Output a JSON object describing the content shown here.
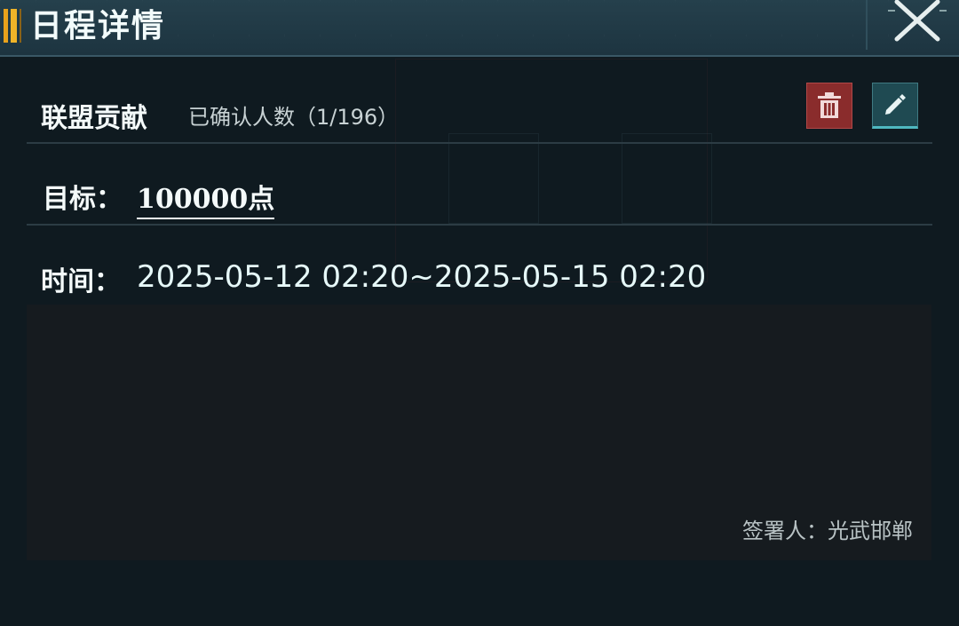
{
  "header": {
    "title": "日程详情"
  },
  "event": {
    "name": "联盟贡献",
    "confirmed_text": "已确认人数（1/196）",
    "target_label": "目标：",
    "target_value": "100000点",
    "time_label": "时间：",
    "time_value": "2025-05-12 02:20~2025-05-15 02:20",
    "signer": "签署人：光武邯郸"
  },
  "actions": {
    "delete_icon": "trash-icon",
    "edit_icon": "pencil-icon",
    "close_icon": "close-icon"
  },
  "colors": {
    "accent": "#f0b428",
    "delete": "#8a2c2c",
    "edit": "#1f4a52"
  }
}
